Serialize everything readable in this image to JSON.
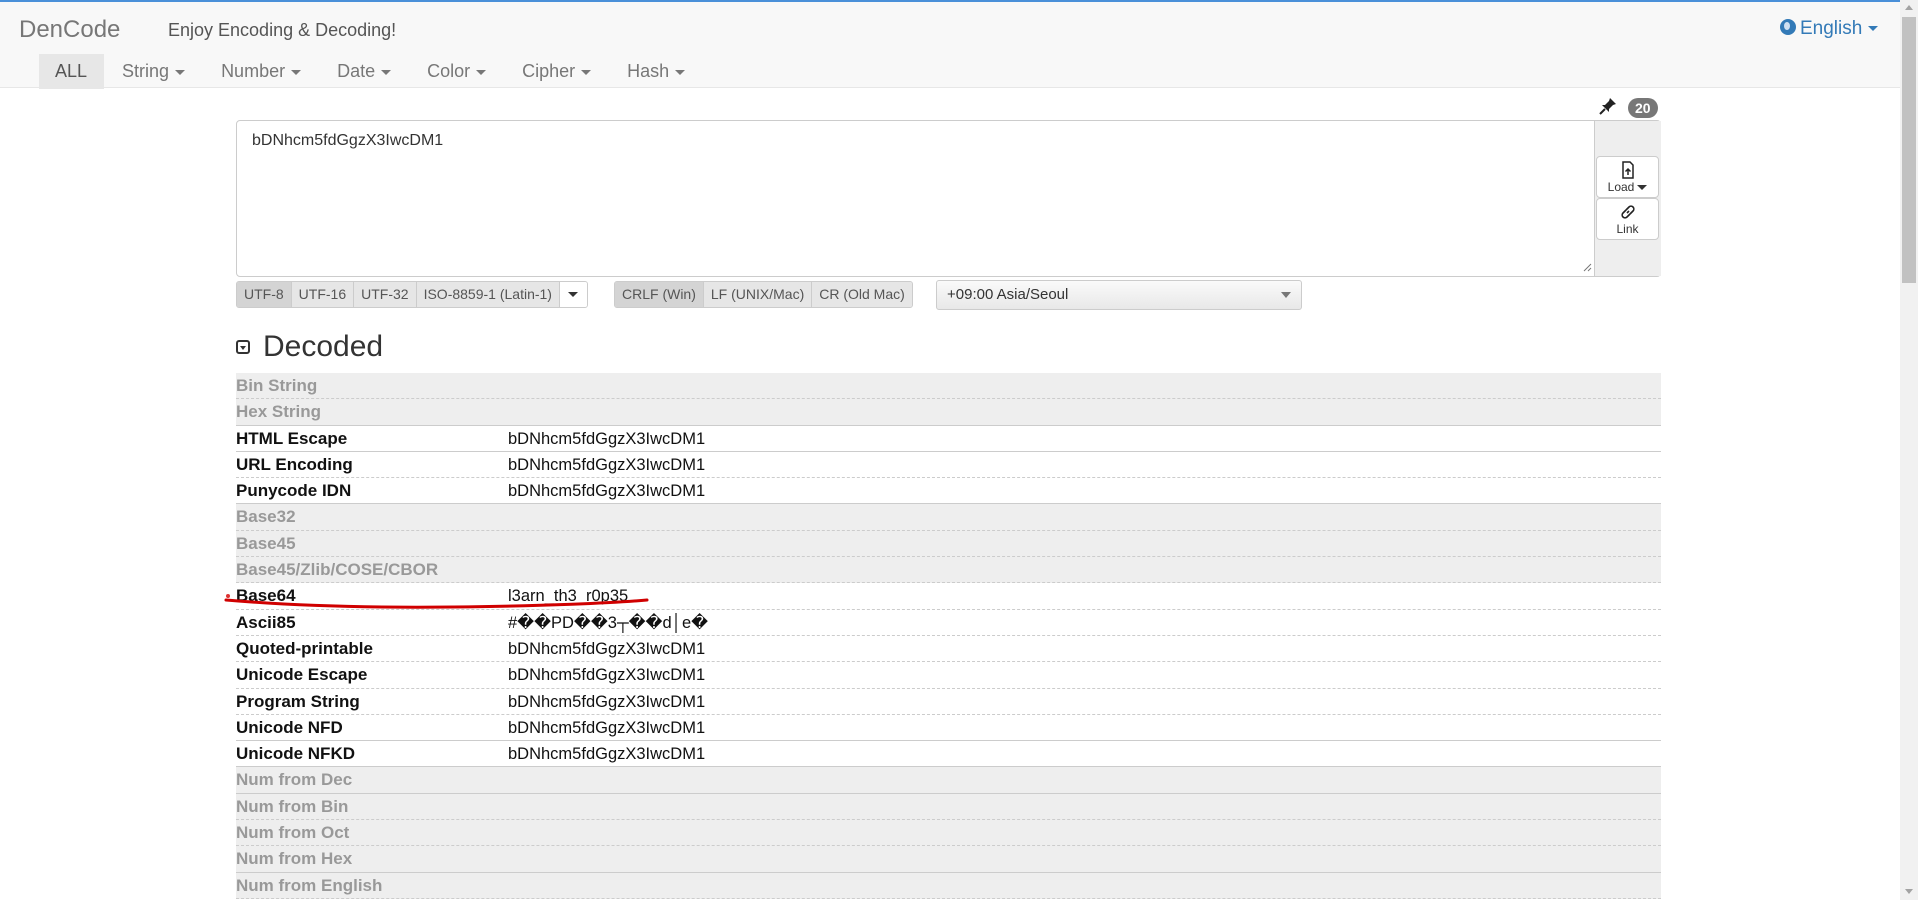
{
  "app": {
    "brand": "DenCode",
    "tagline": "Enjoy Encoding & Decoding!",
    "language": "English"
  },
  "menu": [
    {
      "label": "ALL"
    },
    {
      "label": "String"
    },
    {
      "label": "Number"
    },
    {
      "label": "Date"
    },
    {
      "label": "Color"
    },
    {
      "label": "Cipher"
    },
    {
      "label": "Hash"
    }
  ],
  "input": {
    "value": "bDNhcm5fdGgzX3IwcDM1",
    "length_badge": "20",
    "load_label": "Load",
    "link_label": "Link"
  },
  "encodings": [
    "UTF-8",
    "UTF-16",
    "UTF-32",
    "ISO-8859-1 (Latin-1)"
  ],
  "newlines": [
    "CRLF (Win)",
    "LF (UNIX/Mac)",
    "CR (Old Mac)"
  ],
  "timezone": "+09:00 Asia/Seoul",
  "section": {
    "title": "Decoded"
  },
  "rows": [
    {
      "label": "Bin String",
      "value": "",
      "dim": true
    },
    {
      "label": "Hex String",
      "value": "",
      "dim": true
    },
    {
      "label": "HTML Escape",
      "value": "bDNhcm5fdGgzX3IwcDM1",
      "dim": false
    },
    {
      "label": "URL Encoding",
      "value": "bDNhcm5fdGgzX3IwcDM1",
      "dim": false
    },
    {
      "label": "Punycode IDN",
      "value": "bDNhcm5fdGgzX3IwcDM1",
      "dim": false
    },
    {
      "label": "Base32",
      "value": "",
      "dim": true
    },
    {
      "label": "Base45",
      "value": "",
      "dim": true
    },
    {
      "label": "Base45/Zlib/COSE/CBOR",
      "value": "",
      "dim": true
    },
    {
      "label": "Base64",
      "value": "l3arn_th3_r0p35",
      "dim": false,
      "highlighted": true
    },
    {
      "label": "Ascii85",
      "value": "#��PD��3┬��d│e�",
      "dim": false
    },
    {
      "label": "Quoted-printable",
      "value": "bDNhcm5fdGgzX3IwcDM1",
      "dim": false
    },
    {
      "label": "Unicode Escape",
      "value": "bDNhcm5fdGgzX3IwcDM1",
      "dim": false
    },
    {
      "label": "Program String",
      "value": "bDNhcm5fdGgzX3IwcDM1",
      "dim": false
    },
    {
      "label": "Unicode NFD",
      "value": "bDNhcm5fdGgzX3IwcDM1",
      "dim": false
    },
    {
      "label": "Unicode NFKD",
      "value": "bDNhcm5fdGgzX3IwcDM1",
      "dim": false
    },
    {
      "label": "Num from Dec",
      "value": "",
      "dim": true
    },
    {
      "label": "Num from Bin",
      "value": "",
      "dim": true
    },
    {
      "label": "Num from Oct",
      "value": "",
      "dim": true
    },
    {
      "label": "Num from Hex",
      "value": "",
      "dim": true
    },
    {
      "label": "Num from English",
      "value": "",
      "dim": true
    }
  ],
  "colors": {
    "accent": "#337ab7",
    "annotation": "#d00000"
  }
}
